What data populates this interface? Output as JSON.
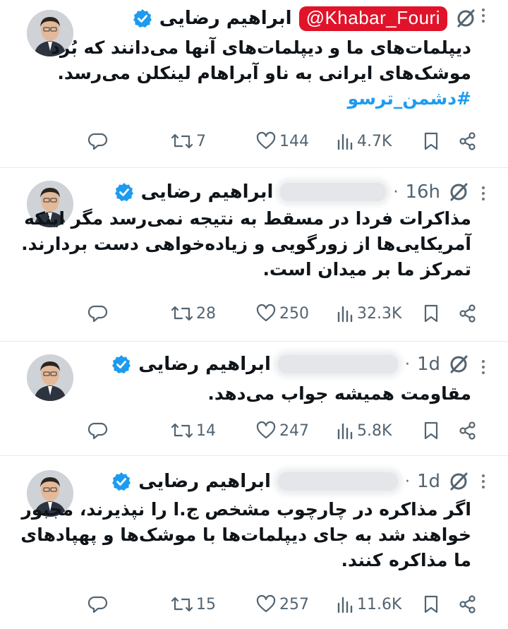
{
  "tweets": [
    {
      "name": "ابراهیم رضایی",
      "handle_overlay": "@Khabar_Fouri",
      "time": "",
      "lines": [
        "دیپلمات‌های ما و دیپلمات‌های آنها می‌دانند که بُرد",
        "موشک‌های ایرانی به ناو آبراهام لینکلن می‌رسد."
      ],
      "hashtag": "#دشمن_ترسو",
      "retweets": "7",
      "likes": "144",
      "views": "4.7K"
    },
    {
      "name": "ابراهیم رضایی",
      "time": "16h",
      "lines": [
        "مذاکرات فردا در مسقط به نتیجه نمی‌رسد مگر اینکه",
        "آمریکایی‌ها از زورگویی و زیاده‌خواهی دست بردارند.",
        "تمرکز ما بر میدان است."
      ],
      "retweets": "28",
      "likes": "250",
      "views": "32.3K"
    },
    {
      "name": "ابراهیم رضایی",
      "time": "1d",
      "lines": [
        "مقاومت همیشه جواب می‌دهد."
      ],
      "retweets": "14",
      "likes": "247",
      "views": "5.8K"
    },
    {
      "name": "ابراهیم رضایی",
      "time": "1d",
      "lines": [
        "اگر مذاکره در چارچوب مشخص ج.ا را نپذیرند، مجبور",
        "خواهند شد به جای دیپلمات‌ها با موشک‌ها و پهپادهای",
        "ما مذاکره کنند."
      ],
      "retweets": "15",
      "likes": "257",
      "views": "11.6K"
    }
  ],
  "icons": {
    "reply": "reply-icon",
    "retweet": "retweet-icon",
    "like": "heart-icon",
    "views": "views-icon",
    "bookmark": "bookmark-icon",
    "share": "share-icon",
    "verified": "verified-badge-icon",
    "grok": "grok-icon",
    "more": "more-icon"
  },
  "colors": {
    "verified": "#1d9bf0",
    "handle_overlay": "#e0132a",
    "action_gray": "#536471",
    "hashtag": "#1d9bf0"
  }
}
